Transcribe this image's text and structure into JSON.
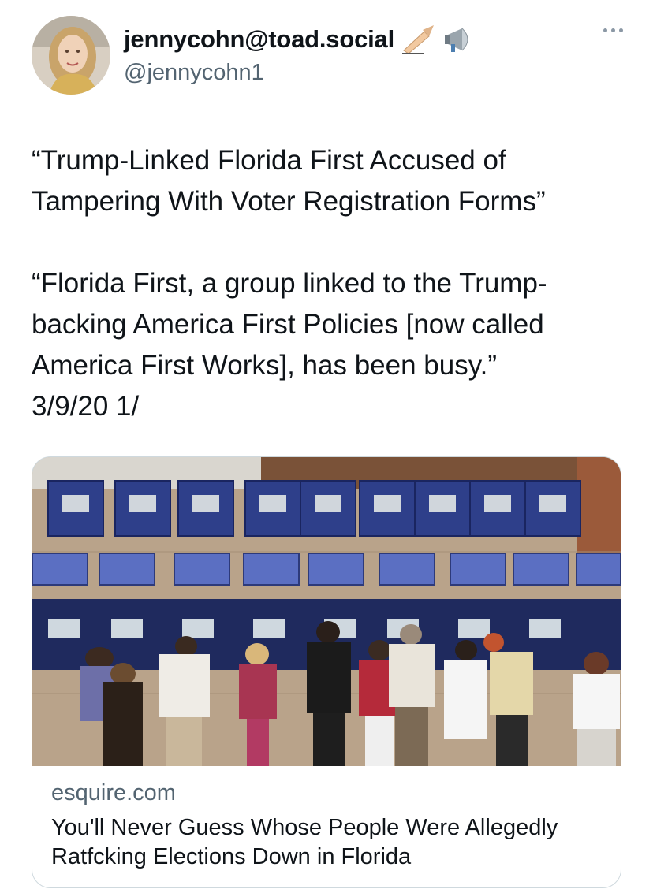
{
  "author": {
    "display_name": "jennycohn@toad.social",
    "handle": "@jennycohn1",
    "name_icons": [
      "writing-hand-icon",
      "megaphone-icon"
    ],
    "avatar_icon": "avatar-photo"
  },
  "more_icon": "more-options-icon",
  "tweet": {
    "text": "“Trump-Linked Florida First Accused of Tampering With Voter Registration Forms”\n\n“Florida First, a group linked to the Trump-backing America First Policies [now called America First Works], has been busy.”\n3/9/20 1/"
  },
  "link_card": {
    "image_description_icon": "voting-booths-photo",
    "domain": "esquire.com",
    "title": "You'll Never Guess Whose People Were Allegedly Ratfcking Elections Down in Florida"
  },
  "colors": {
    "text": "#0f1419",
    "secondary": "#536471",
    "border": "#cfd9de"
  }
}
